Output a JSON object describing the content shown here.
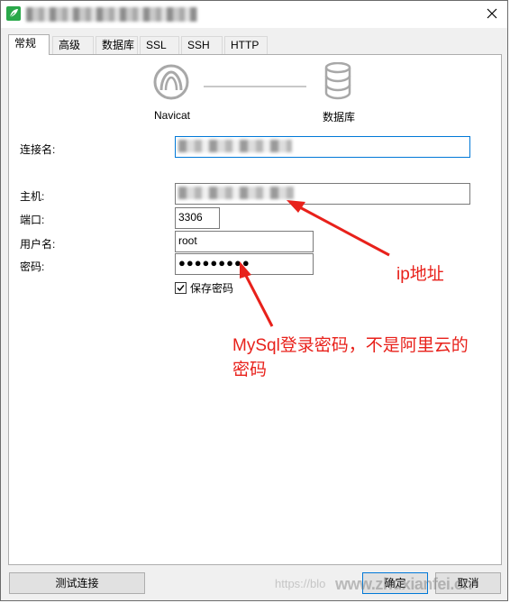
{
  "window": {
    "title": "████████████████",
    "close": "✕"
  },
  "tabs": [
    {
      "label": "常规",
      "active": true
    },
    {
      "label": "高级"
    },
    {
      "label": "数据库"
    },
    {
      "label": "SSL"
    },
    {
      "label": "SSH"
    },
    {
      "label": "HTTP"
    }
  ],
  "graphic": {
    "left_label": "Navicat",
    "right_label": "数据库"
  },
  "fields": {
    "connection_name": {
      "label": "连接名:",
      "value": ""
    },
    "host": {
      "label": "主机:",
      "value": ""
    },
    "port": {
      "label": "端口:",
      "value": "3306"
    },
    "username": {
      "label": "用户名:",
      "value": "root"
    },
    "password": {
      "label": "密码:",
      "value": "●●●●●●●●●"
    }
  },
  "save_password": {
    "label": "保存密码",
    "checked": true
  },
  "buttons": {
    "test": "测试连接",
    "ok": "确定",
    "cancel": "取消"
  },
  "annotations": {
    "ip": "ip地址",
    "mysql_line1": "MySql登录密码，不是阿里云的",
    "mysql_line2": "密码"
  },
  "watermark": {
    "url": "https://blo",
    "site": "www.zhuxianfei.cn"
  },
  "colors": {
    "annotation": "#e8211b",
    "focus": "#0078d7",
    "icon_gray": "#a8a8a8"
  }
}
